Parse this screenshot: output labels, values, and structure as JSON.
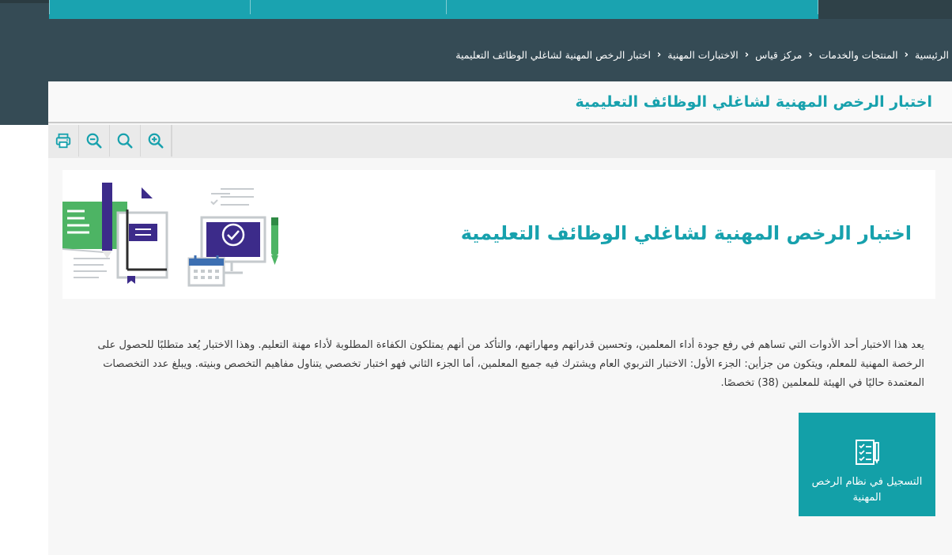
{
  "topnav": {
    "items": [
      "",
      "",
      "",
      "",
      ""
    ]
  },
  "breadcrumb": {
    "items": [
      "الرئيسية",
      "المنتجات والخدمات",
      "مركز قياس",
      "الاختبارات المهنية",
      "اختبار الرخص المهنية لشاغلي الوظائف التعليمية"
    ],
    "separator": "‹"
  },
  "page": {
    "title": "اختبار الرخص المهنية لشاغلي الوظائف التعليمية"
  },
  "toolbar": {
    "icons": [
      "print-icon",
      "zoom-out-icon",
      "search-icon",
      "zoom-in-icon"
    ]
  },
  "banner": {
    "heading": "اختبار الرخص المهنية لشاغلي الوظائف التعليمية"
  },
  "description": {
    "text": "يعد هذا الاختبار أحد الأدوات التي تساهم في رفع جودة أداء المعلمين، وتحسين قدراتهم ومهاراتهم، والتأكد من أنهم يمتلكون الكفاءة المطلوبة لأداء مهنة التعليم. وهذا الاختبار يُعد متطلبًا للحصول على الرخصة المهنية للمعلم، ويتكون من جزأين: الجزء الأول: الاختبار التربوي العام ويشترك فيه جميع المعلمين، أما الجزء الثاني فهو اختبار تخصصي يتناول مفاهيم التخصص وبنيته. ويبلغ عدد التخصصات المعتمدة حاليًا في الهيئة للمعلمين (38) تخصصًا."
  },
  "register": {
    "label": "التسجيل في نظام الرخص المهنية",
    "icon": "checklist-pen-icon"
  },
  "colors": {
    "teal": "#17a1ad",
    "header": "#354b55",
    "panel": "#f7f7f7"
  }
}
